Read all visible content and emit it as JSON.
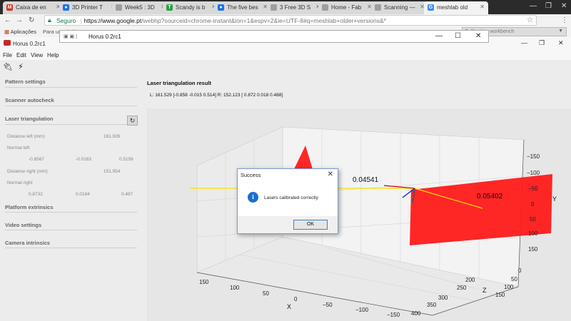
{
  "browser": {
    "tabs": [
      {
        "label": "Caixa de en",
        "icon": "gmail-icon",
        "color": "#d93025"
      },
      {
        "label": "3D Printer T",
        "icon": "globe-icon",
        "color": "#1a73e8"
      },
      {
        "label": "Week5 : 3D",
        "icon": "doc-icon",
        "color": "#888888"
      },
      {
        "label": "Scandy is b",
        "icon": "tc-icon",
        "color": "#2e9e44"
      },
      {
        "label": "The five bes",
        "icon": "globe-icon",
        "color": "#1a73e8"
      },
      {
        "label": "3 Free 3D S",
        "icon": "doc-icon",
        "color": "#888888"
      },
      {
        "label": "Home - Fab",
        "icon": "doc-icon",
        "color": "#888888"
      },
      {
        "label": "Scanning —",
        "icon": "doc-icon",
        "color": "#888888"
      },
      {
        "label": "meshlab old",
        "icon": "google-icon",
        "color": "#4285f4"
      }
    ],
    "secure_label": "Seguro",
    "url_host": "https://www.google.pt",
    "url_rest": "/webhp?sourceid=chrome-instant&ion=1&espv=2&ie=UTF-8#q=meshlab+older+versions&*",
    "apps_label": "Aplicações",
    "bookmark_hint": "Para um rápido ac"
  },
  "overlap_window": {
    "title": "Horus 0.2rc1"
  },
  "horus": {
    "title": "Horus 0.2rc1",
    "menu": [
      "File",
      "Edit",
      "View",
      "Help"
    ],
    "workbench": "Calibration workbench",
    "sections": {
      "pattern": "Pattern settings",
      "autocheck": "Scanner autocheck",
      "laser": "Laser triangulation",
      "platform": "Platform extrinsics",
      "video": "Video settings",
      "camera": "Camera intrinsics"
    },
    "laser": {
      "dist_left_label": "Distance left (mm)",
      "dist_left": "161.926",
      "normal_left_label": "Normal left",
      "normal_left": [
        "-0.8567",
        "-0.0163",
        "0.5156"
      ],
      "dist_right_label": "Distance right (mm)",
      "dist_right": "151.954",
      "normal_right_label": "Normal right",
      "normal_right": [
        "0.8732",
        "0.0184",
        "0.487"
      ]
    },
    "result_title": "Laser triangulation result",
    "result_values": "L: 161.529 [-0.858 -0.015  0.514]  R: 152.123 [ 0.872  0.018  0.488]"
  },
  "plot": {
    "label_left_plane": "0.04541",
    "label_right_plane": "0.05402",
    "x_axis_label": "X",
    "y_axis_label": "Y",
    "z_axis_label": "Z",
    "x_ticks": [
      "150",
      "100",
      "50",
      "0",
      "−50",
      "−100",
      "−150"
    ],
    "y_ticks": [
      "−150",
      "−100",
      "−50",
      "0",
      "50",
      "100",
      "150"
    ],
    "z_ticks": [
      "0",
      "50",
      "100",
      "150",
      "200",
      "250",
      "300",
      "350",
      "400"
    ],
    "plane_color": "#ff1a1a"
  },
  "dialog": {
    "title": "Success",
    "message": "Lasers calibrated correctly",
    "ok_label": "OK"
  }
}
